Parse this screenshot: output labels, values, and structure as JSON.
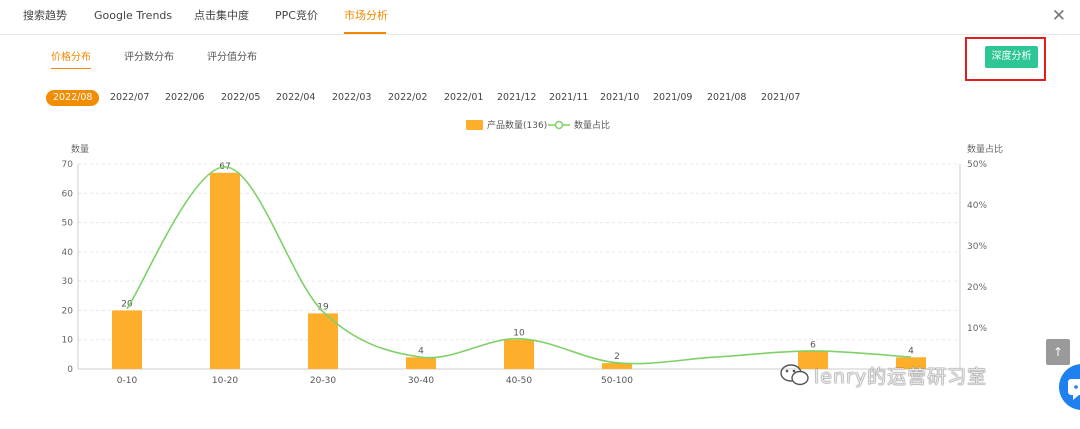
{
  "top_tabs": [
    {
      "label": "搜索趋势",
      "active": false
    },
    {
      "label": "Google Trends",
      "active": false
    },
    {
      "label": "点击集中度",
      "active": false
    },
    {
      "label": "PPC竞价",
      "active": false
    },
    {
      "label": "市场分析",
      "active": true
    }
  ],
  "close_label": "✕",
  "sub_tabs": [
    {
      "label": "价格分布",
      "active": true
    },
    {
      "label": "评分数分布",
      "active": false
    },
    {
      "label": "评分值分布",
      "active": false
    }
  ],
  "deep_analysis_label": "深度分析",
  "dates": [
    "2022/08",
    "2022/07",
    "2022/06",
    "2022/05",
    "2022/04",
    "2022/03",
    "2022/02",
    "2022/01",
    "2021/12",
    "2021/11",
    "2021/10",
    "2021/09",
    "2021/08",
    "2021/07"
  ],
  "active_date": "2022/08",
  "watermark_text": "lenry的运营研习室",
  "colors": {
    "accent": "#f08a00",
    "bar": "#fdae2b",
    "line": "#7ed167",
    "button": "#2ec694",
    "highlight": "#e02020",
    "chat": "#1f80f0"
  },
  "icons": {
    "close": "close-icon",
    "scroll_top": "arrow-up-icon",
    "chat": "chat-bubble-icon",
    "watermark": "wechat-icon"
  },
  "chart_data": {
    "type": "bar",
    "categories": [
      "0-10",
      "10-20",
      "20-30",
      "30-40",
      "40-50",
      "50-100",
      "",
      "",
      ""
    ],
    "tick_labels": [
      "0-10",
      "10-20",
      "20-30",
      "30-40",
      "40-50",
      "50-100"
    ],
    "series": [
      {
        "name": "产品数量(136)",
        "type": "bar",
        "values": [
          20,
          67,
          19,
          4,
          10,
          2,
          0,
          6,
          4
        ],
        "labels": [
          "20",
          "67",
          "19",
          "4",
          "10",
          "2",
          "",
          "6",
          "4"
        ]
      },
      {
        "name": "数量占比",
        "type": "line",
        "values": [
          14.7,
          49.3,
          14.0,
          2.9,
          7.4,
          1.5,
          2.9,
          4.4,
          2.9
        ]
      }
    ],
    "ylabel": "数量",
    "y2label": "数量占比",
    "ylim": [
      0,
      70
    ],
    "y_ticks": [
      0,
      10,
      20,
      30,
      40,
      50,
      60,
      70
    ],
    "y2lim": [
      0,
      50
    ],
    "y2_ticks": [
      "",
      "10%",
      "20%",
      "30%",
      "40%",
      "50%"
    ],
    "legend_position": "top-center",
    "grid": true
  }
}
